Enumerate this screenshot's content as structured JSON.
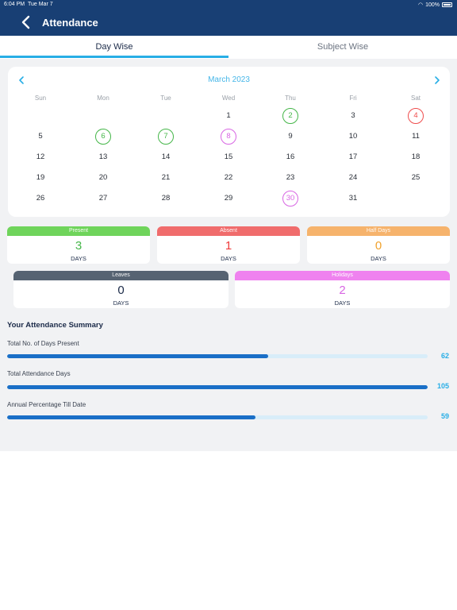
{
  "status_bar": {
    "time": "6:04 PM",
    "date": "Tue Mar 7",
    "battery": "100%"
  },
  "header": {
    "title": "Attendance",
    "back_icon": "chevron-left-icon"
  },
  "tabs": [
    {
      "label": "Day Wise",
      "active": true
    },
    {
      "label": "Subject Wise",
      "active": false
    }
  ],
  "calendar": {
    "month": "March 2023",
    "weekdays": [
      "Sun",
      "Mon",
      "Tue",
      "Wed",
      "Thu",
      "Fri",
      "Sat"
    ],
    "weeks": [
      [
        null,
        null,
        null,
        {
          "d": "1"
        },
        {
          "d": "2",
          "s": "green"
        },
        {
          "d": "3"
        },
        {
          "d": "4",
          "s": "red"
        }
      ],
      [
        {
          "d": "5"
        },
        {
          "d": "6",
          "s": "green"
        },
        {
          "d": "7",
          "s": "green"
        },
        {
          "d": "8",
          "s": "purple"
        },
        {
          "d": "9"
        },
        {
          "d": "10"
        },
        {
          "d": "11"
        }
      ],
      [
        {
          "d": "12"
        },
        {
          "d": "13"
        },
        {
          "d": "14"
        },
        {
          "d": "15"
        },
        {
          "d": "16"
        },
        {
          "d": "17"
        },
        {
          "d": "18"
        }
      ],
      [
        {
          "d": "19"
        },
        {
          "d": "20"
        },
        {
          "d": "21"
        },
        {
          "d": "22"
        },
        {
          "d": "23"
        },
        {
          "d": "24"
        },
        {
          "d": "25"
        }
      ],
      [
        {
          "d": "26"
        },
        {
          "d": "27"
        },
        {
          "d": "28"
        },
        {
          "d": "29"
        },
        {
          "d": "30",
          "s": "purple"
        },
        {
          "d": "31"
        },
        null
      ]
    ]
  },
  "stats": {
    "present": {
      "label": "Present",
      "value": "3",
      "unit": "DAYS",
      "color": "#6fd45b",
      "value_color": "#45b649"
    },
    "absent": {
      "label": "Absent",
      "value": "1",
      "unit": "DAYS",
      "color": "#f06c6c",
      "value_color": "#ef3b3b"
    },
    "half_days": {
      "label": "Half Days",
      "value": "0",
      "unit": "DAYS",
      "color": "#f6b36c",
      "value_color": "#f0a22e"
    },
    "leaves": {
      "label": "Leaves",
      "value": "0",
      "unit": "DAYS",
      "color": "#566372",
      "value_color": "#1b2a48"
    },
    "holidays": {
      "label": "Holidays",
      "value": "2",
      "unit": "DAYS",
      "color": "#ef82ef",
      "value_color": "#d866e3"
    }
  },
  "summary": {
    "title": "Your Attendance Summary",
    "rows": [
      {
        "label": "Total No. of Days Present",
        "value": "62",
        "fraction": 0.62
      },
      {
        "label": "Total Attendance Days",
        "value": "105",
        "fraction": 1.0
      },
      {
        "label": "Annual Percentage Till Date",
        "value": "59",
        "fraction": 0.59
      }
    ]
  }
}
